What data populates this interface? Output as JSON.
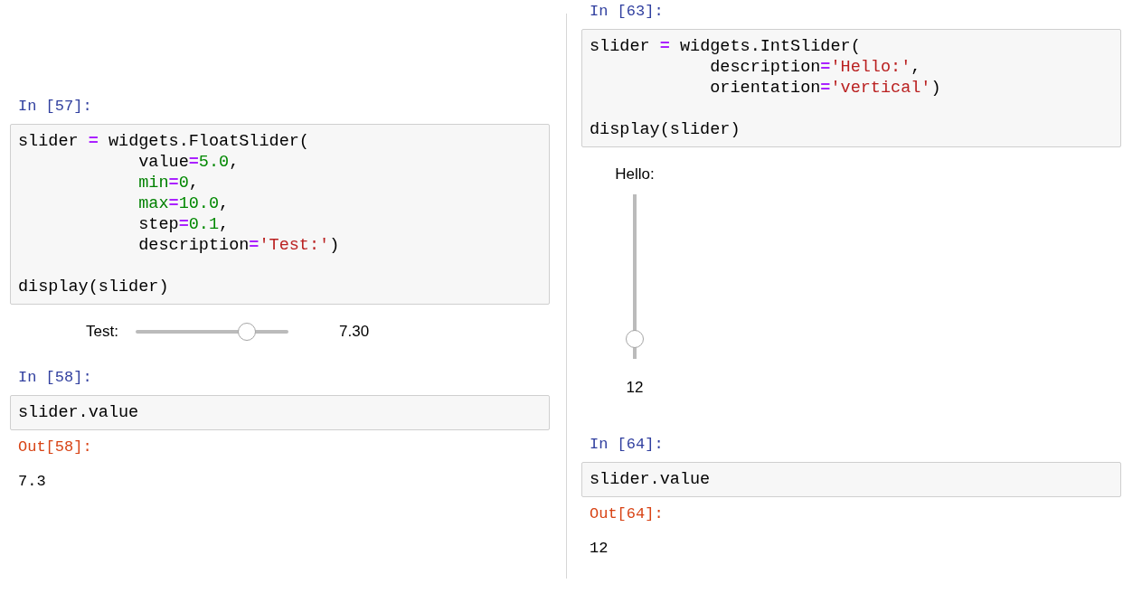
{
  "columns": [
    {
      "cells": [
        {
          "prompt": "In [57]:",
          "code": [
            {
              "tokens": [
                {
                  "kind": "name",
                  "text": "slider "
                },
                {
                  "kind": "op",
                  "text": "="
                },
                {
                  "kind": "name",
                  "text": " widgets.FloatSlider("
                }
              ]
            },
            {
              "tokens": [
                {
                  "kind": "name",
                  "text": "            value"
                },
                {
                  "kind": "op",
                  "text": "="
                },
                {
                  "kind": "number",
                  "text": "5.0"
                },
                {
                  "kind": "name",
                  "text": ","
                }
              ]
            },
            {
              "tokens": [
                {
                  "kind": "builtin",
                  "text": "            min"
                },
                {
                  "kind": "op",
                  "text": "="
                },
                {
                  "kind": "number",
                  "text": "0"
                },
                {
                  "kind": "name",
                  "text": ","
                }
              ]
            },
            {
              "tokens": [
                {
                  "kind": "builtin",
                  "text": "            max"
                },
                {
                  "kind": "op",
                  "text": "="
                },
                {
                  "kind": "number",
                  "text": "10.0"
                },
                {
                  "kind": "name",
                  "text": ","
                }
              ]
            },
            {
              "tokens": [
                {
                  "kind": "name",
                  "text": "            step"
                },
                {
                  "kind": "op",
                  "text": "="
                },
                {
                  "kind": "number",
                  "text": "0.1"
                },
                {
                  "kind": "name",
                  "text": ","
                }
              ]
            },
            {
              "tokens": [
                {
                  "kind": "name",
                  "text": "            description"
                },
                {
                  "kind": "op",
                  "text": "="
                },
                {
                  "kind": "string",
                  "text": "'Test:'"
                },
                {
                  "kind": "name",
                  "text": ")"
                }
              ]
            },
            {
              "tokens": [
                {
                  "kind": "name",
                  "text": "display(slider)"
                }
              ],
              "gap_before": true
            }
          ],
          "widget": {
            "kind": "horizontal",
            "label": "Test:",
            "level": 0.73,
            "readout": "7.30"
          }
        },
        {
          "prompt": "In [58]:",
          "code": [
            {
              "tokens": [
                {
                  "kind": "name",
                  "text": "slider.value"
                }
              ]
            }
          ],
          "output_prompt": "Out[58]:",
          "output": "7.3"
        }
      ]
    },
    {
      "cells": [
        {
          "prompt": "In [63]:",
          "code": [
            {
              "tokens": [
                {
                  "kind": "name",
                  "text": "slider "
                },
                {
                  "kind": "op",
                  "text": "="
                },
                {
                  "kind": "name",
                  "text": " widgets.IntSlider("
                }
              ]
            },
            {
              "tokens": [
                {
                  "kind": "name",
                  "text": "            description"
                },
                {
                  "kind": "op",
                  "text": "="
                },
                {
                  "kind": "string",
                  "text": "'Hello:'"
                },
                {
                  "kind": "name",
                  "text": ","
                }
              ]
            },
            {
              "tokens": [
                {
                  "kind": "name",
                  "text": "            orientation"
                },
                {
                  "kind": "op",
                  "text": "="
                },
                {
                  "kind": "string",
                  "text": "'vertical'"
                },
                {
                  "kind": "name",
                  "text": ")"
                }
              ]
            },
            {
              "tokens": [
                {
                  "kind": "name",
                  "text": "display(slider)"
                }
              ],
              "gap_before": true
            }
          ],
          "widget": {
            "kind": "vertical",
            "label": "Hello:",
            "level": 0.12,
            "readout": "12"
          }
        },
        {
          "prompt": "In [64]:",
          "code": [
            {
              "tokens": [
                {
                  "kind": "name",
                  "text": "slider.value"
                }
              ]
            }
          ],
          "output_prompt": "Out[64]:",
          "output": "12"
        }
      ]
    }
  ]
}
